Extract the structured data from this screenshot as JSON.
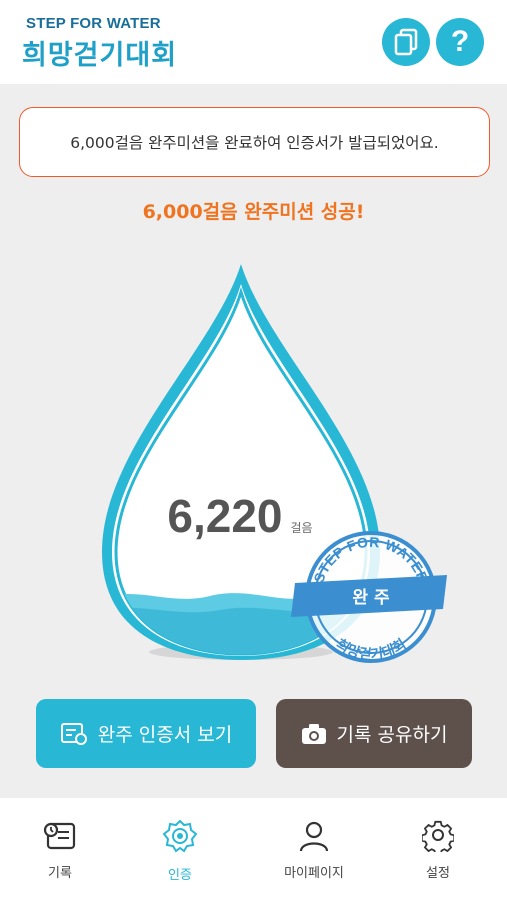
{
  "header": {
    "logo_top": "STEP FOR WATER",
    "logo_main": "희망걷기대회",
    "copy_icon": "copy-icon",
    "help_icon": "help-icon",
    "help_glyph": "?"
  },
  "notice": {
    "text": "6,000걸음 완주미션을 완료하여 인증서가 발급되었어요."
  },
  "success": {
    "text": "6,000걸음 완주미션 성공!"
  },
  "steps": {
    "value": "6,220",
    "unit": "걸음"
  },
  "stamp": {
    "arc_text": "STEP FOR WATER",
    "ribbon": "완 주",
    "bottom_text": "희망걷기대회"
  },
  "buttons": {
    "certificate": "완주 인증서 보기",
    "share": "기록 공유하기"
  },
  "tabs": [
    {
      "label": "기록",
      "icon": "record-icon",
      "active": false
    },
    {
      "label": "인증",
      "icon": "badge-icon",
      "active": true
    },
    {
      "label": "마이페이지",
      "icon": "user-icon",
      "active": false
    },
    {
      "label": "설정",
      "icon": "gear-icon",
      "active": false
    }
  ],
  "colors": {
    "accent": "#29b7d6",
    "logo": "#1fa0c8",
    "success_text": "#f07420",
    "notice_border": "#f05a2a",
    "share_button": "#5e514b"
  }
}
